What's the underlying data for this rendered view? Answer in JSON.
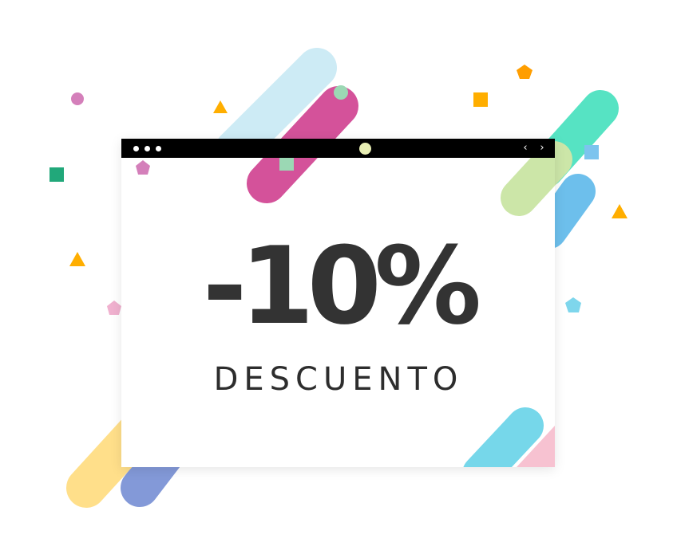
{
  "promo": {
    "discount_text": "-10%",
    "label": "DESCUENTO"
  },
  "browser": {
    "nav_prev_icon": "chevron-left-icon",
    "nav_next_icon": "chevron-right-icon",
    "prev_glyph": "‹",
    "next_glyph": "›"
  },
  "colors": {
    "titlebar": "#000000",
    "text": "#333333",
    "light_blue": "#cdebf5",
    "magenta": "#d4529a",
    "mint": "#9bd8b4",
    "green": "#56e3c3",
    "lime": "#cce6a8",
    "sky": "#6dbfec",
    "yellow": "#ffdf8a",
    "periwinkle": "#8399d8",
    "cyan": "#76d7ea",
    "pink": "#f7c2d1",
    "orange": "#ffae00",
    "dark_green": "#21a87a",
    "purple_dot": "#d47fba"
  }
}
